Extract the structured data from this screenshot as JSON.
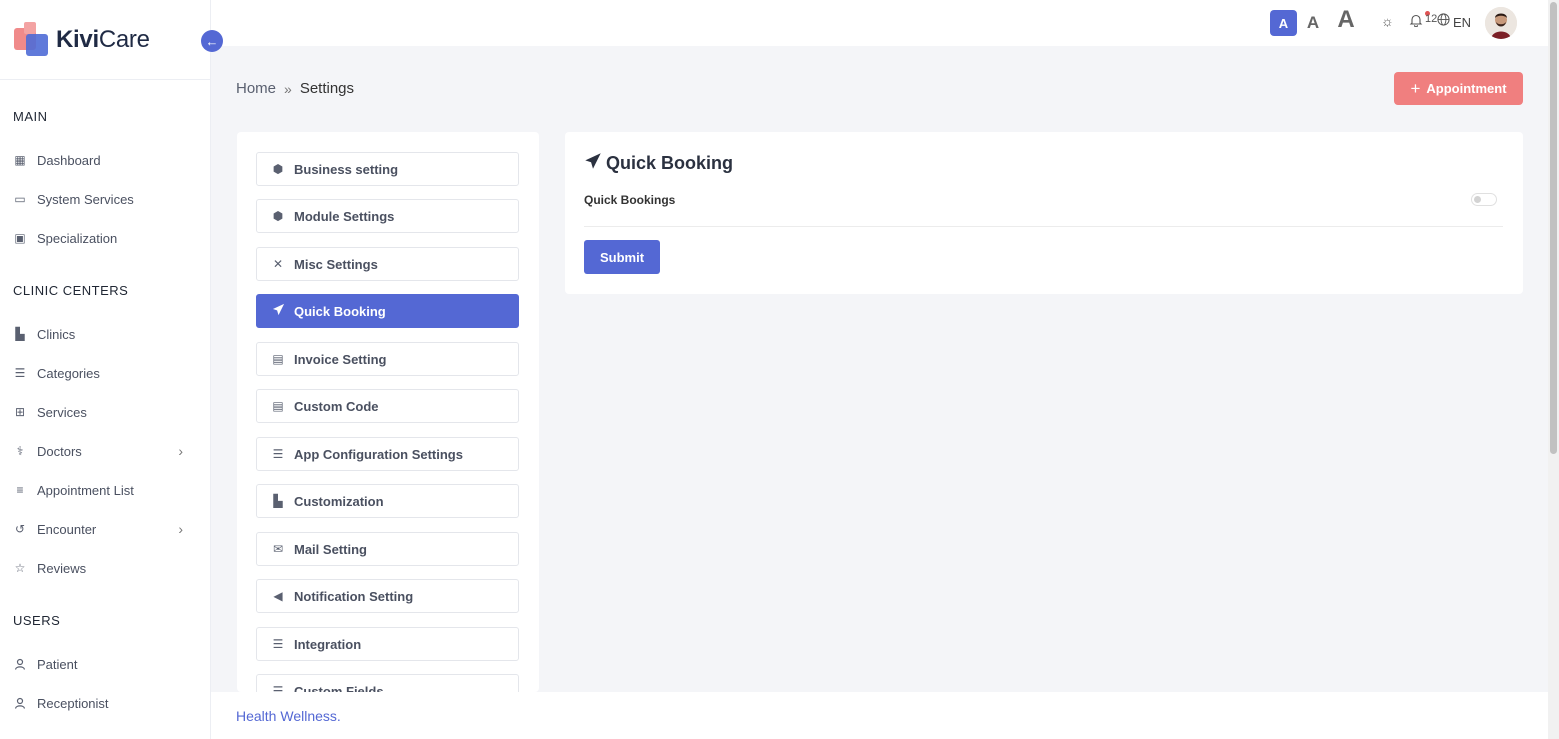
{
  "brand": {
    "name_bold": "Kivi",
    "name_rest": "Care"
  },
  "sidebar": {
    "sections": [
      {
        "title": "MAIN"
      },
      {
        "title": "CLINIC CENTERS"
      },
      {
        "title": "USERS"
      }
    ],
    "items": [
      {
        "label": "Dashboard",
        "icon": "grid-icon"
      },
      {
        "label": "System Services",
        "icon": "monitor-icon"
      },
      {
        "label": "Specialization",
        "icon": "specialization-icon"
      },
      {
        "label": "Clinics",
        "icon": "building-icon"
      },
      {
        "label": "Categories",
        "icon": "list-icon"
      },
      {
        "label": "Services",
        "icon": "medical-bag-icon"
      },
      {
        "label": "Doctors",
        "icon": "stethoscope-icon",
        "has_children": true
      },
      {
        "label": "Appointment List",
        "icon": "sliders-icon"
      },
      {
        "label": "Encounter",
        "icon": "history-icon",
        "has_children": true
      },
      {
        "label": "Reviews",
        "icon": "star-icon"
      },
      {
        "label": "Patient",
        "icon": "user-icon"
      },
      {
        "label": "Receptionist",
        "icon": "user-icon"
      }
    ]
  },
  "topbar": {
    "font_sizes": [
      "A",
      "A",
      "A"
    ],
    "notification_count": "12",
    "language": "EN"
  },
  "breadcrumb": {
    "home": "Home",
    "current": "Settings"
  },
  "actions": {
    "appointment_label": "Appointment"
  },
  "settings_menu": [
    {
      "label": "Business setting",
      "icon": "cube-icon"
    },
    {
      "label": "Module Settings",
      "icon": "cube-icon"
    },
    {
      "label": "Misc Settings",
      "icon": "tools-icon"
    },
    {
      "label": "Quick Booking",
      "icon": "paper-plane-icon",
      "active": true
    },
    {
      "label": "Invoice Setting",
      "icon": "file-icon"
    },
    {
      "label": "Custom Code",
      "icon": "file-code-icon"
    },
    {
      "label": "App Configuration Settings",
      "icon": "sliders-icon"
    },
    {
      "label": "Customization",
      "icon": "palette-icon"
    },
    {
      "label": "Mail Setting",
      "icon": "envelope-icon"
    },
    {
      "label": "Notification Setting",
      "icon": "megaphone-icon"
    },
    {
      "label": "Integration",
      "icon": "sliders-icon"
    },
    {
      "label": "Custom Fields",
      "icon": "list-icon"
    }
  ],
  "content": {
    "title": "Quick Booking",
    "field_label": "Quick Bookings",
    "toggle_on": false,
    "submit_label": "Submit"
  },
  "footer": {
    "text": "Health Wellness."
  },
  "colors": {
    "primary": "#5468d4",
    "accent": "#f07f7f"
  }
}
